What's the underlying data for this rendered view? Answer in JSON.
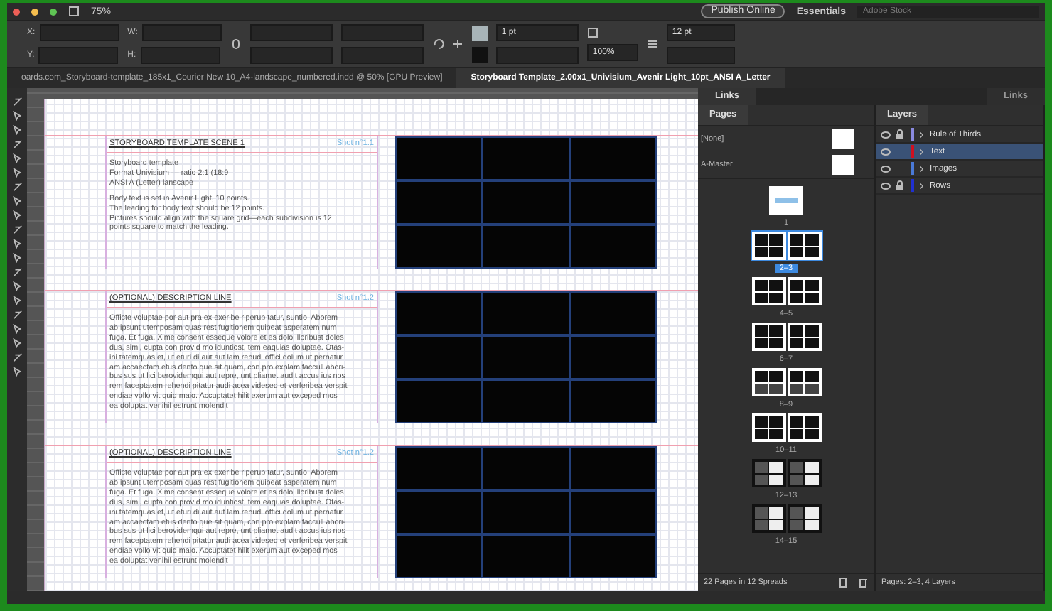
{
  "app": {
    "zoom": "75%",
    "publish_button": "Publish Online",
    "workspace": "Essentials",
    "search": {
      "placeholder": "Adobe Stock"
    }
  },
  "control_bar": {
    "fields": [
      {
        "label": "X:"
      },
      {
        "label": "Y:"
      },
      {
        "label": "W:"
      },
      {
        "label": "H:"
      }
    ],
    "stroke_weight": "1 pt",
    "scale": "100%",
    "leading": "12 pt"
  },
  "doc_tabs": [
    {
      "label": "oards.com_Storyboard-template_185x1_Courier New 10_A4-landscape_numbered.indd @ 50% [GPU Preview]",
      "selected": false
    },
    {
      "label": "Storyboard Template_2.00x1_Univisium_Avenir Light_10pt_ANSI A_Letter",
      "selected": true
    }
  ],
  "scenes": [
    {
      "heading": "STORYBOARD TEMPLATE SCENE 1",
      "shot": "Shot n°1.1",
      "paragraphs": [
        "Storyboard template\nFormat Univisium — ratio 2:1 (18:9\nANSI A (Letter) lanscape",
        "Body text is set in Avenir Light, 10 points.\nThe leading for body text should be 12 points.\nPictures should align with the square grid—each subdivision is 12\npoints square to match the leading."
      ]
    },
    {
      "heading": "(OPTIONAL) DESCRIPTION LINE",
      "shot": "Shot n°1.2",
      "paragraphs": [
        "Officte voluptae por aut pra ex exeribe riperup tatur, suntio. Aborem\nab ipsunt utemposam quas rest fugitionem quibeat asperatem num\nfuga. Et fuga. Xime consent esseque volore et es dolo illoribust doles\ndus, simi, cupta con provid mo iduntiost, tem eaquias doluptae. Otas-\nini tatemquas et, ut eturi di aut aut lam repudi offici dolum ut pernatur\nam accaectam etus dento que sit quam, con pro explam faccull abori-\nbus sus ut lici berovidemqui aut repre, unt pliamet audit accus ius nos\nrem faceptatem rehendi pitatur audi acea videsed et verferibea verspit\nendiae vollo vit quid maio. Accuptatet hilit exerum aut exceped mos\nea doluptat venihil estrunt molendit"
      ]
    },
    {
      "heading": "(OPTIONAL) DESCRIPTION LINE",
      "shot": "Shot n°1.2",
      "paragraphs": [
        "Officte voluptae por aut pra ex exeribe riperup tatur, suntio. Aborem\nab ipsunt utemposam quas rest fugitionem quibeat asperatem num\nfuga. Et fuga. Xime consent esseque volore et es dolo illoribust doles\ndus, simi, cupta con provid mo iduntiost, tem eaquias doluptae. Otas-\nini tatemquas et, ut eturi di aut aut lam repudi offici dolum ut pernatur\nam accaectam etus dento que sit quam, con pro explam faccull abori-\nbus sus ut lici berovidemqui aut repre, unt pliamet audit accus ius nos\nrem faceptatem rehendi pitatur audi acea videsed et verferibea verspit\nendiae vollo vit quid maio. Accuptatet hilit exerum aut exceped mos\nea doluptat venihil estrunt molendit"
      ]
    }
  ],
  "panel_tabs": {
    "links": "Links",
    "hidden_links": "Links"
  },
  "pages_panel": {
    "title": "Pages",
    "masters": [
      {
        "name": "[None]"
      },
      {
        "name": "A-Master"
      }
    ],
    "spreads": [
      {
        "label": "1",
        "kind": "single",
        "selected": false
      },
      {
        "label": "2–3",
        "kind": "grid",
        "selected": true
      },
      {
        "label": "4–5",
        "kind": "grid",
        "selected": false
      },
      {
        "label": "6–7",
        "kind": "grid",
        "selected": false
      },
      {
        "label": "8–9",
        "kind": "wide",
        "selected": false
      },
      {
        "label": "10–11",
        "kind": "grid",
        "selected": false
      },
      {
        "label": "12–13",
        "kind": "dark",
        "selected": false
      },
      {
        "label": "14–15",
        "kind": "dark",
        "selected": false
      }
    ],
    "footer": "22 Pages in 12 Spreads"
  },
  "layers_panel": {
    "title": "Layers",
    "layers": [
      {
        "name": "Rule of Thirds",
        "color": "#8a8ae0",
        "locked": true,
        "selected": false
      },
      {
        "name": "Text",
        "color": "#d01020",
        "locked": false,
        "selected": true
      },
      {
        "name": "Images",
        "color": "#4a7ad8",
        "locked": false,
        "selected": false
      },
      {
        "name": "Rows",
        "color": "#2030d0",
        "locked": true,
        "selected": false
      }
    ],
    "footer": "Pages: 2–3, 4 Layers"
  }
}
